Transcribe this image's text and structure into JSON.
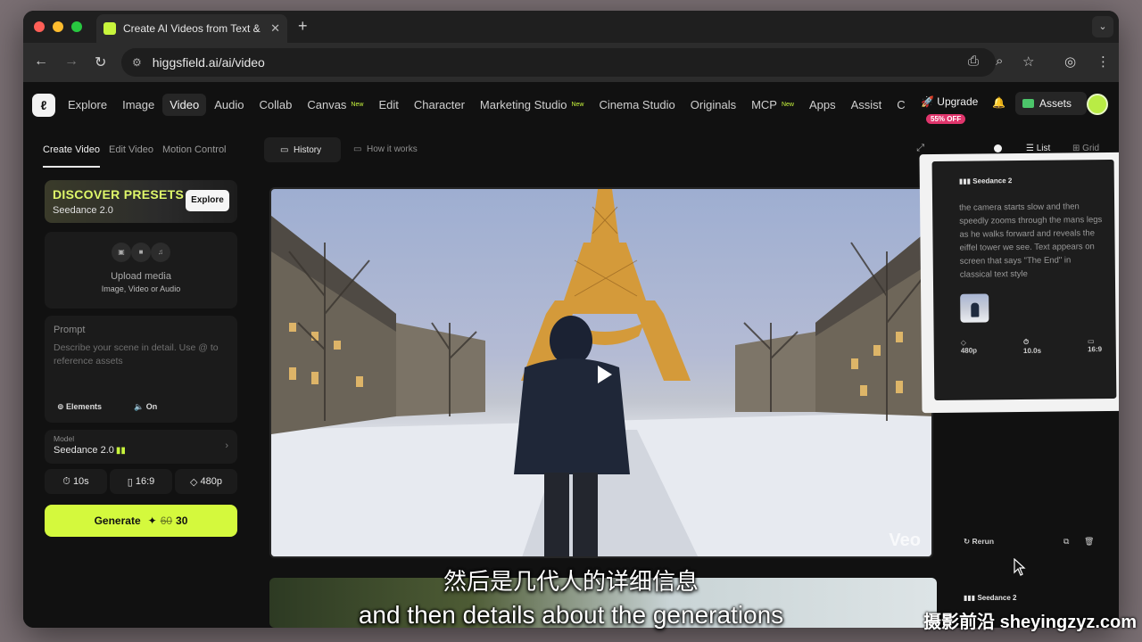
{
  "browser": {
    "tab_title": "Create AI Videos from Text &",
    "url": "higgsfield.ai/ai/video"
  },
  "nav": {
    "items": [
      {
        "label": "Explore",
        "badge": ""
      },
      {
        "label": "Image",
        "badge": ""
      },
      {
        "label": "Video",
        "badge": ""
      },
      {
        "label": "Audio",
        "badge": ""
      },
      {
        "label": "Collab",
        "badge": ""
      },
      {
        "label": "Canvas",
        "badge": "New"
      },
      {
        "label": "Edit",
        "badge": ""
      },
      {
        "label": "Character",
        "badge": ""
      },
      {
        "label": "Marketing Studio",
        "badge": "New"
      },
      {
        "label": "Cinema Studio",
        "badge": ""
      },
      {
        "label": "Originals",
        "badge": ""
      },
      {
        "label": "MCP",
        "badge": "New"
      },
      {
        "label": "Apps",
        "badge": ""
      },
      {
        "label": "Assist",
        "badge": ""
      },
      {
        "label": "C",
        "badge": ""
      }
    ],
    "upgrade_label": "Upgrade",
    "upgrade_badge": "55% OFF",
    "assets_label": "Assets"
  },
  "left": {
    "tabs": [
      "Create Video",
      "Edit Video",
      "Motion Control"
    ],
    "promo_title": "DISCOVER PRESETS",
    "promo_subtitle": "Seedance 2.0",
    "promo_button": "Explore",
    "upload_title": "Upload media",
    "upload_subtitle": "Image, Video or Audio",
    "prompt_label": "Prompt",
    "prompt_placeholder": "Describe your scene in detail. Use @ to reference assets",
    "elements_label": "Elements",
    "on_label": "On",
    "model_label": "Model",
    "model_value": "Seedance 2.0",
    "duration": "10s",
    "aspect": "16:9",
    "resolution": "480p",
    "generate_label": "Generate",
    "cost_old": "60",
    "cost_new": "30"
  },
  "main": {
    "history_label": "History",
    "how_label": "How it works",
    "video_watermark": "Veo"
  },
  "right": {
    "list_label": "List",
    "grid_label": "Grid",
    "card_model": "Seedance 2",
    "card_prompt": "the camera starts slow and then speedly zooms through the mans legs as he walks forward and reveals the eiffel tower we see. Text appears on screen that says \"The End\" in classical text style",
    "card_resolution": "480p",
    "card_duration": "10.0s",
    "card_aspect": "16:9",
    "rerun_label": "Rerun",
    "card2_model": "Seedance 2"
  },
  "subtitles": {
    "chinese": "然后是几代人的详细信息",
    "english": "and then details about the generations",
    "watermark": "摄影前沿 sheyingzyz.com"
  },
  "colors": {
    "accent": "#d4f93d",
    "offer_badge": "#e0356c"
  }
}
